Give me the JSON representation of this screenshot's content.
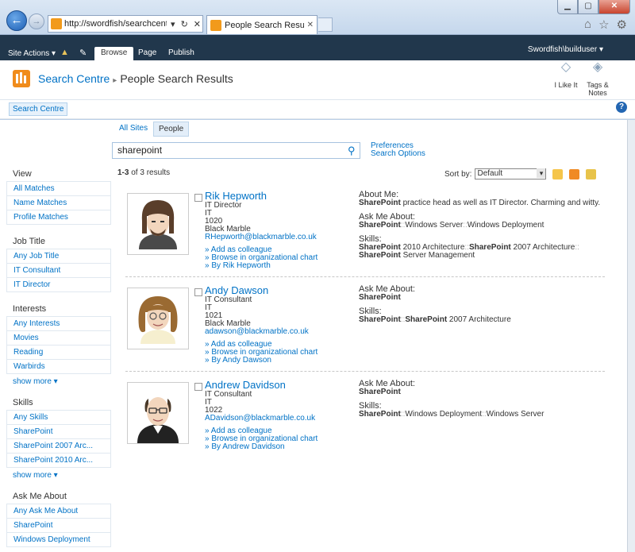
{
  "browser": {
    "url": "http://swordfish/searchcentre/",
    "tab_title": "People Search Results: shar...",
    "addr_controls": [
      "▾",
      "↻",
      "✕"
    ]
  },
  "ribbon": {
    "site_actions": "Site Actions",
    "tabs": [
      "Browse",
      "Page",
      "Publish"
    ],
    "user": "Swordfish\\builduser"
  },
  "title": {
    "site": "Search Centre",
    "page": "People Search Results",
    "i_like_it": "I Like It",
    "tags_notes": "Tags & Notes"
  },
  "topnav": {
    "item": "Search Centre"
  },
  "scopes": {
    "all": "All Sites",
    "people": "People"
  },
  "search": {
    "query": "sharepoint",
    "preferences": "Preferences",
    "options": "Search Options"
  },
  "refiners": {
    "view": {
      "heading": "View",
      "items": [
        "All Matches",
        "Name Matches",
        "Profile Matches"
      ]
    },
    "job_title": {
      "heading": "Job Title",
      "items": [
        "Any Job Title",
        "IT Consultant",
        "IT Director"
      ]
    },
    "interests": {
      "heading": "Interests",
      "items": [
        "Any Interests",
        "Movies",
        "Reading",
        "Warbirds"
      ],
      "more": "show more ▾"
    },
    "skills": {
      "heading": "Skills",
      "items": [
        "Any Skills",
        "SharePoint",
        "SharePoint 2007 Arc...",
        "SharePoint 2010 Arc..."
      ],
      "more": "show more ▾"
    },
    "ask_me_about": {
      "heading": "Ask Me About",
      "items": [
        "Any Ask Me About",
        "SharePoint",
        "Windows Deployment"
      ]
    }
  },
  "results_header": {
    "range": "1-3",
    "of_text": "of 3 results",
    "sort_label": "Sort by:",
    "sort_value": "Default"
  },
  "results": [
    {
      "name": "Rik Hepworth",
      "title": "IT Director",
      "dept": "IT",
      "phone": "1020",
      "company": "Black Marble",
      "email": "RHepworth@blackmarble.co.uk",
      "add": "» Add as colleague",
      "browse": "» Browse in organizational chart",
      "by": "» By Rik Hepworth",
      "about_label": "About Me:",
      "about_bold": "SharePoint",
      "about_text": " practice head as well as IT Director. Charming and witty.",
      "ask_label": "Ask Me About:",
      "ask_bold": "SharePoint",
      "ask_text": "Windows Server",
      "ask_text2": "Windows Deployment",
      "skills_label": "Skills:",
      "skills_1_bold": "SharePoint",
      "skills_1_text": " 2010 Architecture",
      "skills_2_bold": "SharePoint",
      "skills_2_text": " 2007 Architecture",
      "skills_3_bold": "SharePoint",
      "skills_3_text": " Server Management"
    },
    {
      "name": "Andy Dawson",
      "title": "IT Consultant",
      "dept": "IT",
      "phone": "1021",
      "company": "Black Marble",
      "email": "adawson@blackmarble.co.uk",
      "add": "» Add as colleague",
      "browse": "» Browse in organizational chart",
      "by": "» By Andy Dawson",
      "ask_label": "Ask Me About:",
      "ask_bold": "SharePoint",
      "skills_label": "Skills:",
      "skills_1_bold": "SharePoint",
      "skills_2_bold": "SharePoint",
      "skills_2_text": " 2007 Architecture"
    },
    {
      "name": "Andrew Davidson",
      "title": "IT Consultant",
      "dept": "IT",
      "phone": "1022",
      "email": "ADavidson@blackmarble.co.uk",
      "add": "» Add as colleague",
      "browse": "» Browse in organizational chart",
      "by": "» By Andrew Davidson",
      "ask_label": "Ask Me About:",
      "ask_bold": "SharePoint",
      "skills_label": "Skills:",
      "skills_1_bold": "SharePoint",
      "skills_2_text": "Windows Deployment",
      "skills_3_text": "Windows Server"
    }
  ],
  "separator": "::"
}
